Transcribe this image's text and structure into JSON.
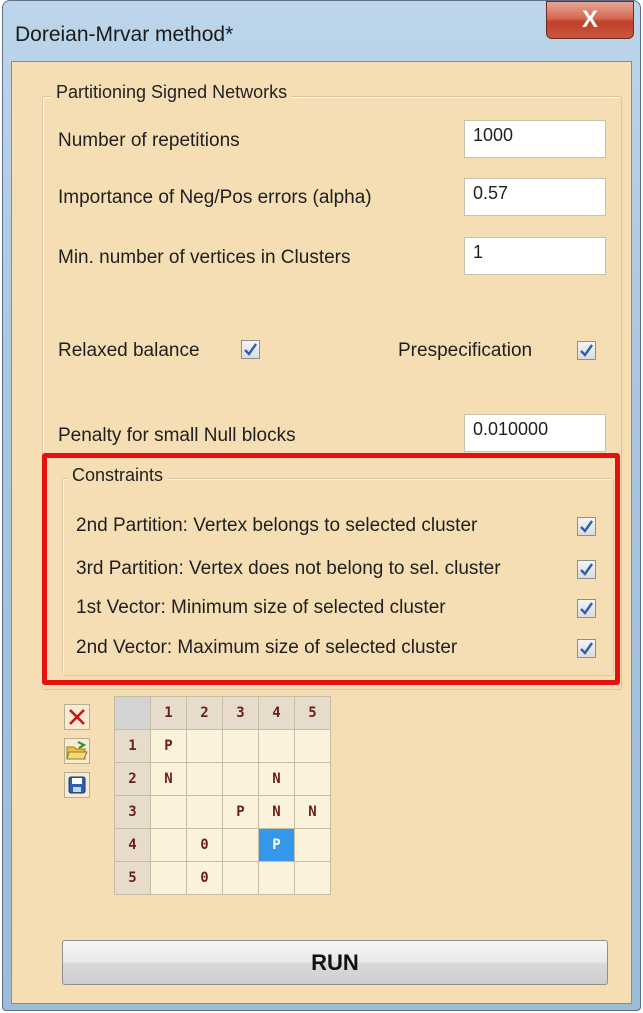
{
  "window": {
    "title": "Doreian-Mrvar method*",
    "close_label": "X"
  },
  "main_group": {
    "legend": "Partitioning Signed Networks",
    "repetitions": {
      "label": "Number of repetitions",
      "value": "1000"
    },
    "alpha": {
      "label": "Importance of Neg/Pos errors (alpha)",
      "value": "0.57"
    },
    "min_vertices": {
      "label": "Min. number of vertices in Clusters",
      "value": "1"
    },
    "relaxed_balance": {
      "label": "Relaxed balance",
      "checked": true
    },
    "prespecification": {
      "label": "Prespecification",
      "checked": true
    },
    "penalty": {
      "label": "Penalty for small Null blocks",
      "value": "0.010000"
    }
  },
  "constraints": {
    "legend": "Constraints",
    "items": [
      {
        "label": "2nd Partition: Vertex belongs to selected cluster",
        "checked": true
      },
      {
        "label": "3rd Partition: Vertex does not belong to sel. cluster",
        "checked": true
      },
      {
        "label": "1st Vector: Minimum size of selected cluster",
        "checked": true
      },
      {
        "label": "2nd Vector: Maximum size of selected cluster",
        "checked": true
      }
    ]
  },
  "toolbar": {
    "delete_icon": "delete-icon",
    "open_icon": "open-folder-icon",
    "save_icon": "save-icon"
  },
  "grid": {
    "col_headers": [
      "1",
      "2",
      "3",
      "4",
      "5"
    ],
    "row_headers": [
      "1",
      "2",
      "3",
      "4",
      "5"
    ],
    "cells": [
      [
        "P",
        "",
        "",
        "",
        ""
      ],
      [
        "N",
        "",
        "",
        "N",
        ""
      ],
      [
        "",
        "",
        "P",
        "N",
        "N"
      ],
      [
        "",
        "0",
        "",
        "P",
        ""
      ],
      [
        "",
        "0",
        "",
        "",
        ""
      ]
    ],
    "selected": {
      "row": 3,
      "col": 3
    }
  },
  "run_label": "RUN",
  "colors": {
    "panel": "#f5deb3",
    "highlight": "#e4120f",
    "selected_cell": "#3597ea"
  }
}
